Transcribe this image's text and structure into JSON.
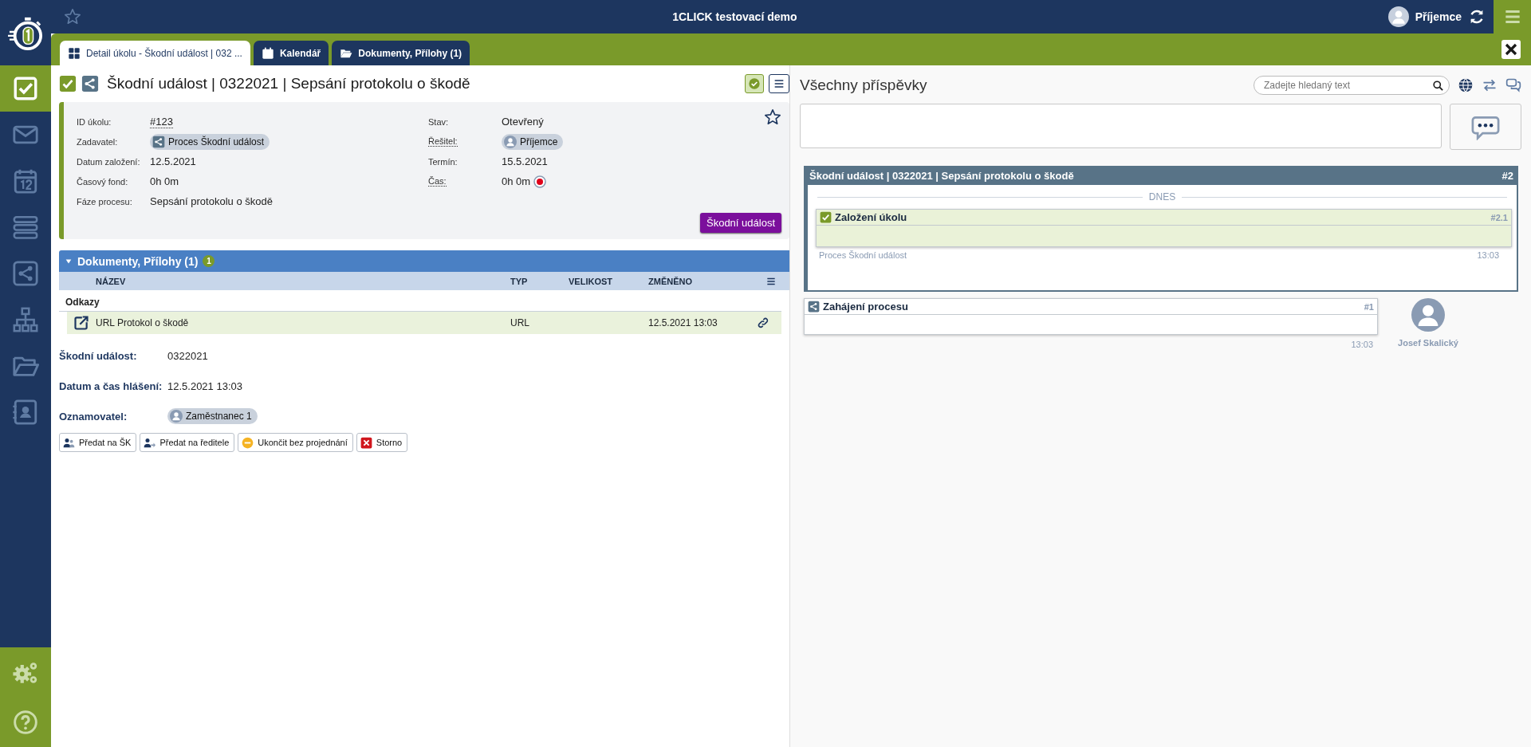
{
  "header": {
    "title": "1CLICK testovací demo",
    "user": "Příjemce"
  },
  "sidebar": {
    "items": [
      {
        "selected": true
      },
      {
        "selected": false
      },
      {
        "selected": false
      },
      {
        "selected": false
      },
      {
        "selected": false
      },
      {
        "selected": false
      },
      {
        "selected": false
      },
      {
        "selected": false
      }
    ]
  },
  "tabs": [
    {
      "label": "Detail úkolu - Škodní událost | 032 ...",
      "selected": true
    },
    {
      "label": "Kalendář",
      "selected": false
    },
    {
      "label": "Dokumenty, Přílohy (1)",
      "selected": false
    }
  ],
  "task": {
    "title": "Škodní událost | 0322021 | Sepsání protokolu o škodě",
    "completed": true,
    "fields_left": [
      {
        "label": "ID úkolu:",
        "value": "#123",
        "kind": "link",
        "dotted_label": false
      },
      {
        "label": "Zadavatel:",
        "value": "Proces Škodní událost",
        "kind": "process-chip",
        "dotted_label": false
      },
      {
        "label": "Datum založení:",
        "value": "12.5.2021",
        "kind": "text",
        "dotted_label": false
      },
      {
        "label": "Časový fond:",
        "value": "0h 0m",
        "kind": "text",
        "dotted_label": false
      },
      {
        "label": "Fáze procesu:",
        "value": "Sepsání protokolu o škodě",
        "kind": "text",
        "dotted_label": false
      }
    ],
    "fields_right": [
      {
        "label": "Stav:",
        "value": "Otevřený",
        "kind": "text",
        "dotted_label": false
      },
      {
        "label": "Řešitel:",
        "value": "Příjemce",
        "kind": "user-chip",
        "dotted_label": true
      },
      {
        "label": "Termín:",
        "value": "15.5.2021",
        "kind": "text",
        "dotted_label": false
      },
      {
        "label": "Čas:",
        "value": "0h 0m",
        "kind": "timer",
        "dotted_label": true
      }
    ],
    "favorite": false,
    "phase_button": "Škodní událost"
  },
  "documents": {
    "title": "Dokumenty, Přílohy (1)",
    "count": "1",
    "expanded": true,
    "columns": [
      "NÁZEV",
      "TYP",
      "VELIKOST",
      "ZMĚNĚNO"
    ],
    "groups": [
      {
        "name": "Odkazy",
        "rows": [
          {
            "name": "URL Protokol o škodě",
            "type": "URL",
            "changed": "12.5.2021 13:03"
          }
        ]
      }
    ]
  },
  "form": [
    {
      "label": "Škodní událost:",
      "value": "0322021",
      "kind": "text"
    },
    {
      "label": "Datum a čas hlášení:",
      "value": "12.5.2021 13:03",
      "kind": "text"
    },
    {
      "label": "Oznamovatel:",
      "value": "Zaměstnanec 1",
      "kind": "user-chip"
    }
  ],
  "actions": [
    {
      "label": "Předat na ŠK",
      "kind": "users"
    },
    {
      "label": "Předat na ředitele",
      "kind": "user-forward"
    },
    {
      "label": "Ukončit bez projednání",
      "kind": "end"
    },
    {
      "label": "Storno",
      "kind": "cancel"
    }
  ],
  "feed": {
    "title": "Všechny příspěvky",
    "search": {
      "placeholder": "Zadejte hledaný text"
    },
    "thread": {
      "title": "Škodní událost | 0322021 | Sepsání protokolu o škodě",
      "number": "#2",
      "day": "DNES",
      "entries": [
        {
          "title": "Založení úkolu",
          "number": "#2.1",
          "kind": "done"
        }
      ],
      "source": "Proces Škodní událost",
      "time": "13:03"
    },
    "posts": [
      {
        "title": "Zahájení procesu",
        "number": "#1",
        "kind": "process",
        "time": "13:03",
        "author": "Josef Skalický"
      }
    ]
  }
}
